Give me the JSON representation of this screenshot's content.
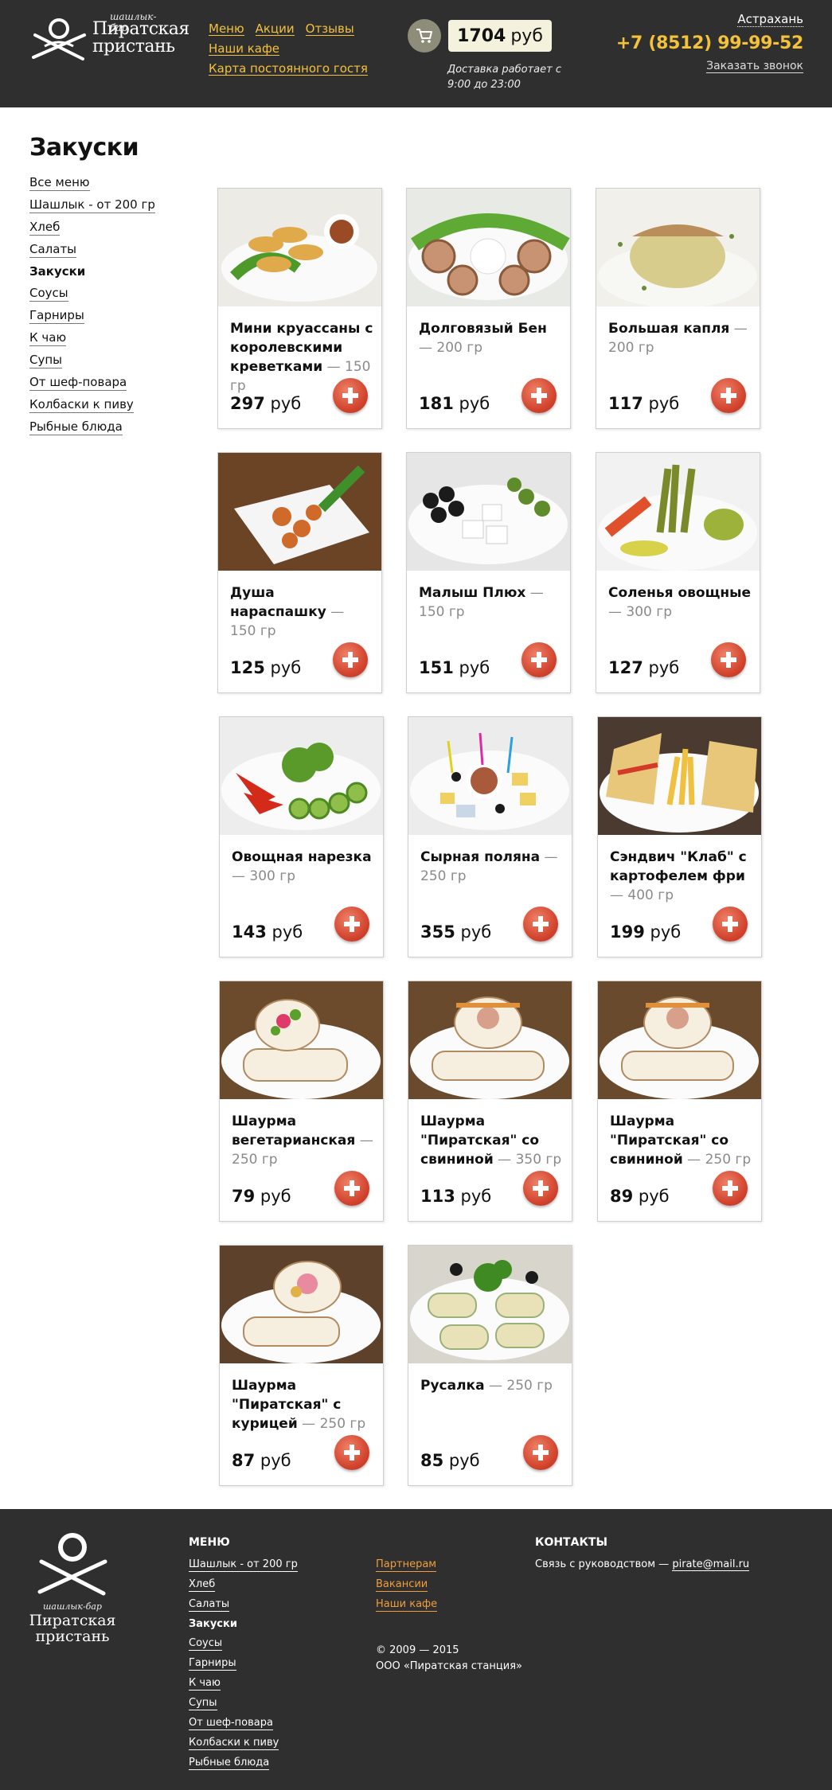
{
  "header": {
    "brand_small": "шашлык-бар",
    "brand_big": "Пиратская пристань",
    "nav": [
      "Меню",
      "Акции",
      "Отзывы",
      "Наши кафе",
      "Карта постоянного гостя"
    ],
    "cart_total_value": "1704",
    "cart_total_unit": "руб",
    "delivery": "Доставка работает с 9:00 до 23:00",
    "city": "Астрахань",
    "phone": "+7 (8512) 99-99-52",
    "callback": "Заказать звонок"
  },
  "page_title": "Закуски",
  "sidebar": {
    "items": [
      "Все меню",
      "Шашлык - от 200 гр",
      "Хлеб",
      "Салаты",
      "Закуски",
      "Соусы",
      "Гарниры",
      "К чаю",
      "Супы",
      "От шеф-повара",
      "Колбаски к пиву",
      "Рыбные блюда"
    ],
    "active": "Закуски"
  },
  "currency": "руб",
  "products": [
    {
      "name": "Мини круассаны с королевскими креветками",
      "weight": "150 гр",
      "price": "297"
    },
    {
      "name": "Долговязый Бен",
      "weight": "200 гр",
      "price": "181"
    },
    {
      "name": "Большая капля",
      "weight": "200 гр",
      "price": "117"
    },
    {
      "name": "Душа нараспашку",
      "weight": "150 гр",
      "price": "125"
    },
    {
      "name": "Малыш Плюх",
      "weight": "150 гр",
      "price": "151"
    },
    {
      "name": "Соленья овощные",
      "weight": "300 гр",
      "price": "127"
    },
    {
      "name": "Овощная нарезка",
      "weight": "300 гр",
      "price": "143"
    },
    {
      "name": "Сырная поляна",
      "weight": "250 гр",
      "price": "355"
    },
    {
      "name": "Сэндвич \"Клаб\" с картофелем фри",
      "weight": "400 гр",
      "price": "199"
    },
    {
      "name": "Шаурма вегетарианская",
      "weight": "250 гр",
      "price": "79"
    },
    {
      "name": "Шаурма \"Пиратская\" со свининой",
      "weight": "350 гр",
      "price": "113"
    },
    {
      "name": "Шаурма \"Пиратская\" со свининой",
      "weight": "250 гр",
      "price": "89"
    },
    {
      "name": "Шаурма \"Пиратская\" с курицей",
      "weight": "250 гр",
      "price": "87"
    },
    {
      "name": "Русалка",
      "weight": "250 гр",
      "price": "85"
    }
  ],
  "footer": {
    "menu_title": "МЕНЮ",
    "menu": [
      "Шашлык - от 200 гр",
      "Хлеб",
      "Салаты",
      "Закуски",
      "Соусы",
      "Гарниры",
      "К чаю",
      "Супы",
      "От шеф-повара",
      "Колбаски к пиву",
      "Рыбные блюда"
    ],
    "active": "Закуски",
    "links": [
      "Партнерам",
      "Вакансии",
      "Наши кафе"
    ],
    "copyright": "© 2009 — 2015",
    "company": "ООО «Пиратская станция»",
    "contacts_title": "КОНТАКТЫ",
    "contacts_text": "Связь с руководством —",
    "email": "pirate@mail.ru"
  },
  "colors": {
    "header_bg": "#2f2f2f",
    "accent": "#f3c23a",
    "link_orange": "#f29d3c",
    "add_button": "#d1422c"
  }
}
